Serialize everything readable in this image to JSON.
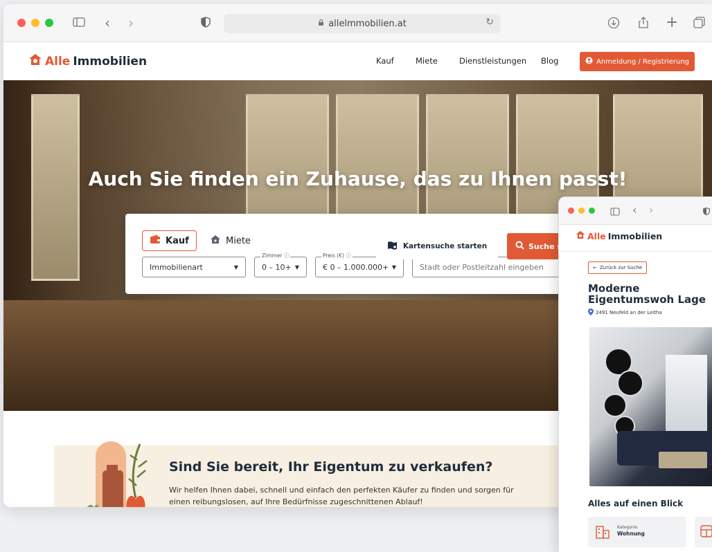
{
  "browser": {
    "url": "allelmmobilien.at"
  },
  "site": {
    "logo_part1": "Alle",
    "logo_part2": "Immobilien",
    "nav": [
      "Kauf",
      "Miete",
      "Dienstleistungen",
      "Blog"
    ],
    "register_label": "Anmeldung / Registrierung"
  },
  "hero": {
    "title": "Auch Sie finden ein Zuhause, das zu Ihnen passt!",
    "tab_buy": "Kauf",
    "tab_rent": "Miete",
    "type_value": "Immobilienart",
    "rooms_label": "Zimmer",
    "rooms_value": "0 – 10+",
    "price_label": "Preis (€)",
    "price_value": "€ 0 – 1.000.000+",
    "city_placeholder": "Stadt oder Postleitzahl eingeben",
    "map_button": "Kartensuche starten",
    "search_button": "Suche s"
  },
  "sell": {
    "title": "Sind Sie bereit, Ihr Eigentum zu verkaufen?",
    "text": "Wir helfen Ihnen dabei, schnell und einfach den perfekten Käufer zu finden und sorgen für einen reibungslosen, auf Ihre Bedürfnisse zugeschnittenen Ablauf!"
  },
  "overlay": {
    "logo_part1": "Alle",
    "logo_part2": "Immobilien",
    "back_label": "Zurück zur Suche",
    "title": "Moderne Eigentumswoh Lage",
    "location": "2491 Neufeld an der Leitha",
    "overview_heading": "Alles auf einen Blick",
    "category_label": "Kategorie:",
    "category_value": "Wohnung"
  },
  "colors": {
    "brand": "#e25a35",
    "navy": "#1f2d3d"
  }
}
